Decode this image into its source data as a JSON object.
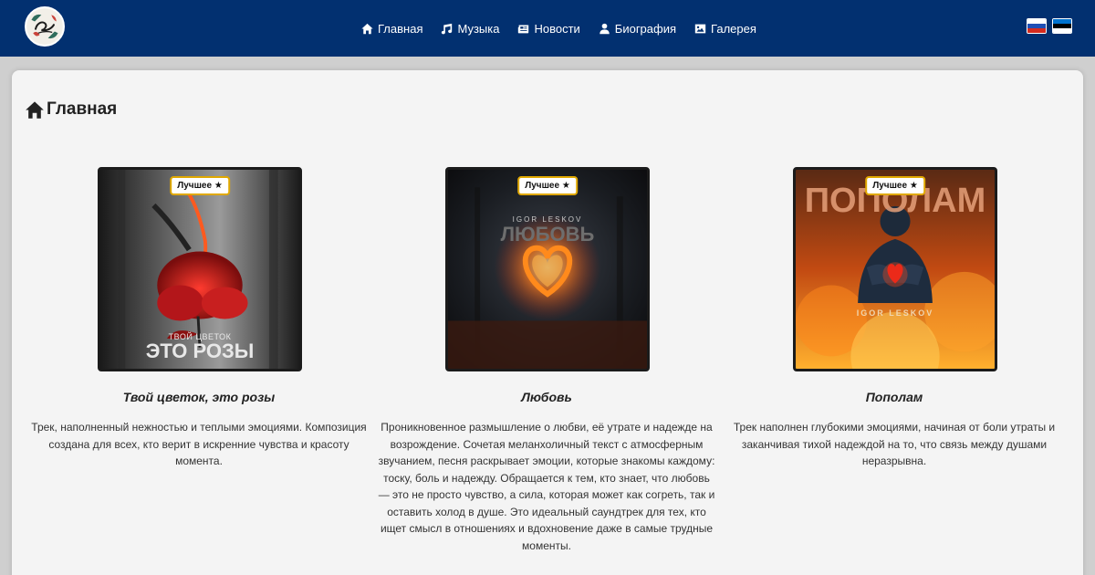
{
  "header": {
    "logo_alt": "Leskov",
    "nav": [
      {
        "label": "Главная",
        "icon": "home-icon"
      },
      {
        "label": "Музыка",
        "icon": "music-note-icon"
      },
      {
        "label": "Новости",
        "icon": "newspaper-icon"
      },
      {
        "label": "Биография",
        "icon": "user-icon"
      },
      {
        "label": "Галерея",
        "icon": "image-icon"
      }
    ],
    "languages": [
      {
        "code": "ru",
        "colors": [
          "#ffffff",
          "#1f4fb5",
          "#d52b1e"
        ]
      },
      {
        "code": "et",
        "colors": [
          "#0072ce",
          "#000000",
          "#ffffff"
        ]
      }
    ]
  },
  "main": {
    "title": "Главная",
    "title_icon": "home-icon",
    "tracks": [
      {
        "badge": "Лучшее ★",
        "cover_text_small": "ТВОЙ ЦВЕТОК",
        "cover_text_big": "ЭТО РОЗЫ",
        "title": "Твой цветок, это розы",
        "description": "Трек, наполненный нежностью и теплыми эмоциями. Композиция создана для всех, кто верит в искренние чувства и красоту момента."
      },
      {
        "badge": "Лучшее ★",
        "cover_text_small": "IGOR LESKOV",
        "cover_text_big": "ЛЮБОВЬ",
        "title": "Любовь",
        "description": "Проникновенное размышление о любви, её утрате и надежде на возрождение. Сочетая меланхоличный текст с атмосферным звучанием, песня раскрывает эмоции, которые знакомы каждому: тоску, боль и надежду. Обращается к тем, кто знает, что любовь — это не просто чувство, а сила, которая может как согреть, так и оставить холод в душе. Это идеальный саундтрек для тех, кто ищет смысл в отношениях и вдохновение даже в самые трудные моменты."
      },
      {
        "badge": "Лучшее ★",
        "cover_text_small": "IGOR LESKOV",
        "cover_text_big": "ПОПОЛАМ",
        "title": "Пополам",
        "description": "Трек наполнен глубокими эмоциями, начиная от боли утраты и заканчивая тихой надеждой на то, что связь между душами неразрывна."
      }
    ]
  },
  "colors": {
    "header_bg": "#023070",
    "badge_border": "#e0a800",
    "panel_bg": "#f4f4f4"
  }
}
